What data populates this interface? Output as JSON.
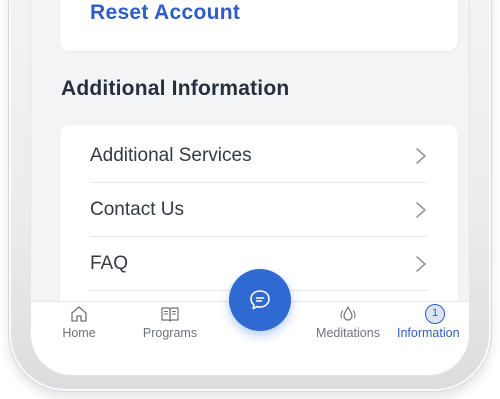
{
  "account": {
    "reset_label": "Reset Account"
  },
  "section": {
    "title": "Additional Information"
  },
  "info_items": [
    {
      "label": "Additional Services"
    },
    {
      "label": "Contact Us"
    },
    {
      "label": "FAQ"
    }
  ],
  "nav": {
    "home": "Home",
    "programs": "Programs",
    "meditations": "Meditations",
    "information": "Information",
    "information_badge": "1"
  },
  "icons": {
    "home": "home-icon",
    "programs": "book-icon",
    "chat": "chat-bubble-icon",
    "meditations": "drop-icon",
    "chevron": "chevron-right-icon"
  },
  "colors": {
    "accent": "#2f5dc7",
    "fab": "#2f6ad3",
    "background": "#f3f4f6",
    "text": "#333a44"
  }
}
